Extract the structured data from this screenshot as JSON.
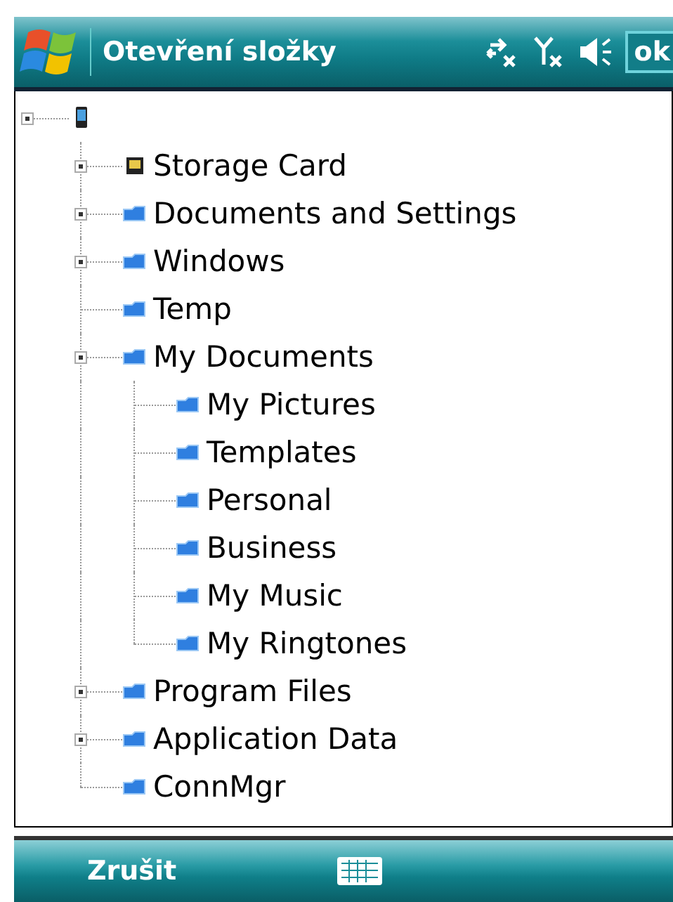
{
  "title_bar": {
    "title": "Otevření složky",
    "ok_button": "ok"
  },
  "tree": {
    "kind": "device",
    "expandable": true,
    "children": [
      {
        "label": "Storage Card",
        "kind": "card",
        "expandable": true
      },
      {
        "label": "Documents and Settings",
        "kind": "folder",
        "expandable": true
      },
      {
        "label": "Windows",
        "kind": "folder",
        "expandable": true
      },
      {
        "label": "Temp",
        "kind": "folder",
        "expandable": false
      },
      {
        "label": "My Documents",
        "kind": "folder",
        "expandable": true,
        "children": [
          {
            "label": "My Pictures",
            "kind": "folder",
            "expandable": false
          },
          {
            "label": "Templates",
            "kind": "folder",
            "expandable": false
          },
          {
            "label": "Personal",
            "kind": "folder",
            "expandable": false
          },
          {
            "label": "Business",
            "kind": "folder",
            "expandable": false
          },
          {
            "label": "My Music",
            "kind": "folder",
            "expandable": false
          },
          {
            "label": "My Ringtones",
            "kind": "folder",
            "expandable": false
          }
        ]
      },
      {
        "label": "Program Files",
        "kind": "folder",
        "expandable": true
      },
      {
        "label": "Application Data",
        "kind": "folder",
        "expandable": true
      },
      {
        "label": "ConnMgr",
        "kind": "folder",
        "expandable": false
      }
    ]
  },
  "softkeys": {
    "left": "Zrušit"
  }
}
